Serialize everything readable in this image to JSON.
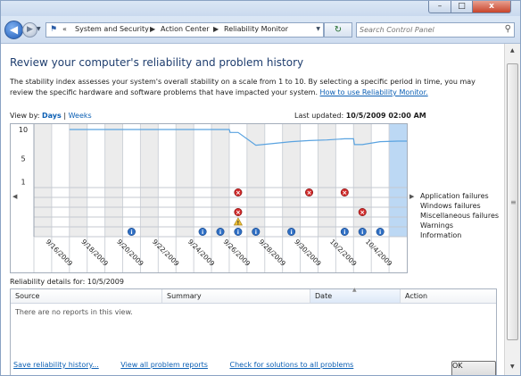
{
  "window": {
    "minimize_glyph": "–",
    "maximize_glyph": "□",
    "close_glyph": "x"
  },
  "nav": {
    "back_glyph": "◀",
    "forward_glyph": "▶",
    "refresh_glyph": "↻",
    "dropdown_glyph": "▼",
    "overflow_glyph": "«"
  },
  "breadcrumb": [
    "System and Security",
    "Action Center",
    "Reliability Monitor"
  ],
  "breadcrumb_separator": "▶",
  "search": {
    "placeholder": "Search Control Panel",
    "icon": "search-icon"
  },
  "page": {
    "title": "Review your computer's reliability and problem history",
    "description": "The stability index assesses your system's overall stability on a scale from 1 to 10. By selecting a specific period in time, you may review the specific hardware and software problems that have impacted your system.",
    "help_link": "How to use Reliability Monitor.",
    "view_by_label": "View by:",
    "view_days": "Days",
    "view_sep": "|",
    "view_weeks": "Weeks",
    "last_updated_label": "Last updated:",
    "last_updated_value": "10/5/2009 02:00 AM"
  },
  "legend": [
    "Application failures",
    "Windows failures",
    "Miscellaneous failures",
    "Warnings",
    "Information"
  ],
  "chart_data": {
    "type": "line",
    "y_ticks": [
      10,
      5,
      1
    ],
    "ylim": [
      0,
      10
    ],
    "selected_column": 20,
    "columns": 21,
    "x_tick_labels": [
      "9/16/2009",
      "9/18/2009",
      "9/20/2009",
      "9/22/2009",
      "9/24/2009",
      "9/26/2009",
      "9/28/2009",
      "9/30/2009",
      "10/2/2009",
      "10/4/2009"
    ],
    "stability_index": [
      null,
      null,
      10,
      10,
      10,
      10,
      10,
      10,
      10,
      10,
      10,
      9.5,
      7.3,
      7.6,
      7.9,
      8.1,
      8.2,
      8.4,
      7.4,
      7.9,
      8.0
    ],
    "event_markers": [
      {
        "row": "Application failures",
        "columns": [
          11,
          15,
          17
        ]
      },
      {
        "row": "Miscellaneous failures",
        "columns": [
          11,
          18
        ]
      },
      {
        "row": "Warnings",
        "columns": [
          11
        ]
      },
      {
        "row": "Information",
        "columns": [
          5,
          9,
          10,
          11,
          12,
          14,
          17,
          18,
          19
        ]
      }
    ],
    "icon_glyphs": {
      "error": "⊗",
      "warning": "!",
      "info": "i"
    }
  },
  "chart_nav": {
    "left_glyph": "◀",
    "right_glyph": "▶"
  },
  "details": {
    "label": "Reliability details for: 10/5/2009",
    "columns": [
      "Source",
      "Summary",
      "Date",
      "Action"
    ],
    "sort_glyph": "▲",
    "empty_message": "There are no reports in this view."
  },
  "footer": {
    "links": [
      "Save reliability history...",
      "View all problem reports",
      "Check for solutions to all problems"
    ],
    "ok_label": "OK"
  },
  "scrollbar": {
    "up_glyph": "▲",
    "down_glyph": "▼",
    "grip_glyph": "≡"
  },
  "colors": {
    "stability_line": "#5aa3e0",
    "selected_column": "#bcd8f4",
    "error": "#d12b2b",
    "info": "#2f6fc4",
    "warning": "#f1c232"
  }
}
